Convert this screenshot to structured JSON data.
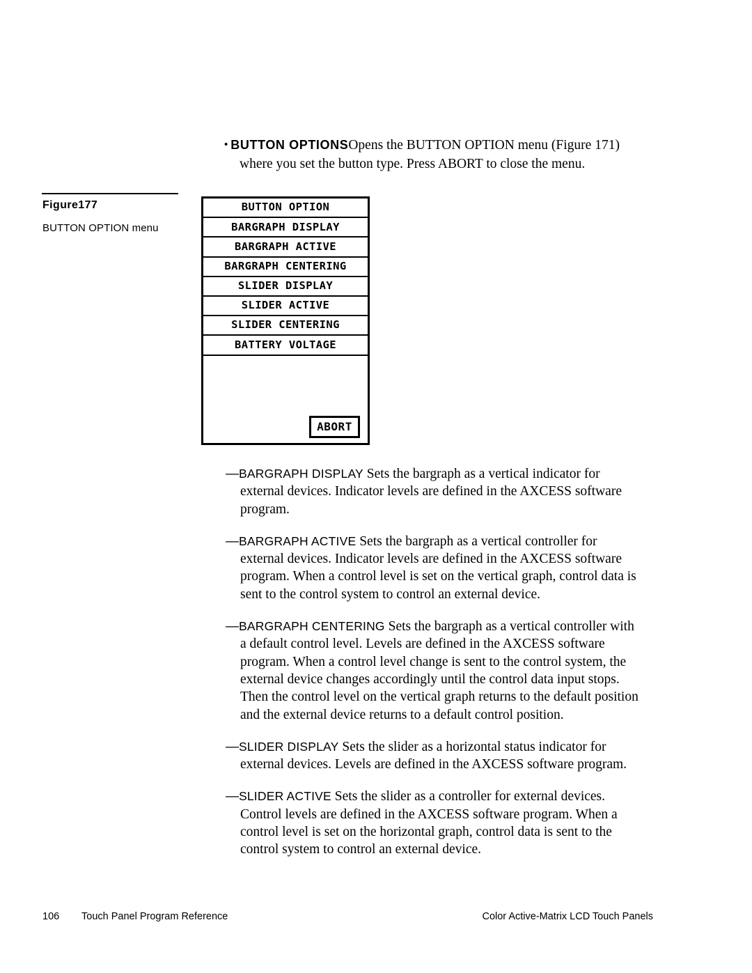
{
  "intro": {
    "bullet_glyph": "•",
    "term": "BUTTON OPTIONS",
    "line1_rest": "Opens the BUTTON OPTION menu (Figure 171)",
    "line2": "where you set the button type. Press ABORT to close the menu."
  },
  "figure": {
    "number": "Figure177",
    "caption": "BUTTON OPTION menu"
  },
  "panel": {
    "menu_items": [
      {
        "label": "BUTTON OPTION"
      },
      {
        "label": "BARGRAPH DISPLAY"
      },
      {
        "label": "BARGRAPH ACTIVE"
      },
      {
        "label": "BARGRAPH CENTERING"
      },
      {
        "label": "SLIDER DISPLAY"
      },
      {
        "label": "SLIDER ACTIVE"
      },
      {
        "label": "SLIDER CENTERING"
      },
      {
        "label": "BATTERY VOLTAGE"
      }
    ],
    "abort_label": "ABORT"
  },
  "definitions": {
    "dash": "—",
    "items": [
      {
        "term": "BARGRAPH DISPLAY",
        "text": " Sets the bargraph as a vertical indicator for external devices. Indicator levels are defined in the AXCESS software program."
      },
      {
        "term": "BARGRAPH ACTIVE",
        "text": " Sets the bargraph as a vertical controller for external devices. Indicator levels are defined in the AXCESS software program. When a control level is set on the vertical graph, control data is sent to the control system to control an external device."
      },
      {
        "term": "BARGRAPH CENTERING",
        "text": " Sets the bargraph as a vertical controller with a default control level. Levels are defined in the AXCESS software program. When a control level change is sent to the control system, the external device changes accordingly until the control data input stops. Then the control level on the vertical graph returns to the default position and the external device returns to a default control position."
      },
      {
        "term": "SLIDER DISPLAY",
        "text": " Sets the slider as a horizontal status indicator for external devices. Levels are defined in the AXCESS software program."
      },
      {
        "term": "SLIDER ACTIVE",
        "text": " Sets the slider as a controller for external devices. Control levels are defined in the AXCESS software program. When a control level is set on the horizontal graph, control data is sent to the control system to control an external device."
      }
    ]
  },
  "footer": {
    "page_number": "106",
    "left_text": "Touch Panel Program Reference",
    "right_text": "Color Active-Matrix LCD Touch Panels"
  }
}
